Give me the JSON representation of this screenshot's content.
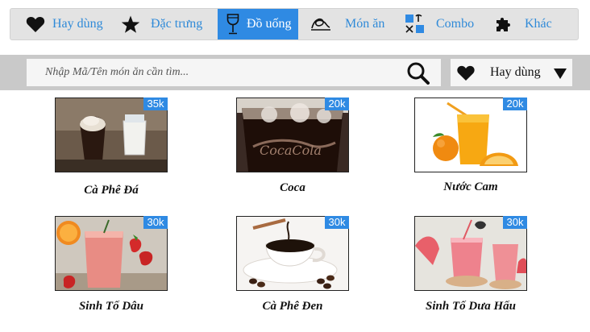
{
  "tabs": [
    {
      "label": "Hay dùng",
      "icon": "heart-icon"
    },
    {
      "label": "Đặc trưng",
      "icon": "star-icon"
    },
    {
      "label": "Đồ uống",
      "icon": "wine-glass-icon",
      "active": true
    },
    {
      "label": "Món ăn",
      "icon": "food-icon"
    },
    {
      "label": "Combo",
      "icon": "combo-icon"
    },
    {
      "label": "Khác",
      "icon": "puzzle-icon"
    }
  ],
  "search": {
    "placeholder": "Nhập Mã/Tên món ăn cần tìm...",
    "value": ""
  },
  "filter": {
    "label": "Hay dùng",
    "icon": "heart-icon"
  },
  "colors": {
    "accent": "#2f8ae3",
    "tab_text": "#2f8ad8",
    "search_bar": "#c9c9c9"
  },
  "items": [
    {
      "name": "Cà Phê Đá",
      "price": "35k",
      "image": "iced-coffee-photo"
    },
    {
      "name": "Coca",
      "price": "20k",
      "image": "coca-cola-glass-photo"
    },
    {
      "name": "Nước Cam",
      "price": "20k",
      "image": "orange-juice-photo"
    },
    {
      "name": "Sinh Tố Dâu",
      "price": "30k",
      "image": "strawberry-smoothie-photo"
    },
    {
      "name": "Cà Phê Đen",
      "price": "30k",
      "image": "black-coffee-photo"
    },
    {
      "name": "Sinh Tố Dưa Hấu",
      "price": "30k",
      "image": "watermelon-smoothie-photo"
    }
  ]
}
